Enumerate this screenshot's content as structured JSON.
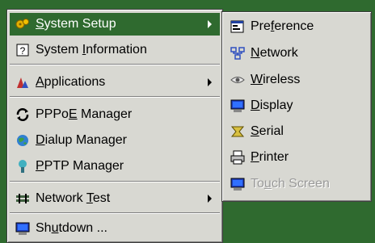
{
  "main_menu": {
    "items": [
      {
        "pre": "",
        "u": "S",
        "post": "ystem Setup",
        "icon": "system-setup-icon",
        "submenu": true,
        "highlighted": true
      },
      {
        "pre": "System ",
        "u": "I",
        "post": "nformation",
        "icon": "help-icon",
        "submenu": false
      },
      {
        "pre": "",
        "u": "A",
        "post": "pplications",
        "icon": "applications-icon",
        "submenu": true
      },
      {
        "pre": "PPPo",
        "u": "E",
        "post": " Manager",
        "icon": "pppoe-icon",
        "submenu": false
      },
      {
        "pre": "",
        "u": "D",
        "post": "ialup Manager",
        "icon": "dialup-icon",
        "submenu": false
      },
      {
        "pre": "",
        "u": "P",
        "post": "PTP Manager",
        "icon": "pptp-icon",
        "submenu": false
      },
      {
        "pre": "Network ",
        "u": "T",
        "post": "est",
        "icon": "network-test-icon",
        "submenu": true
      },
      {
        "pre": "Sh",
        "u": "u",
        "post": "tdown ...",
        "icon": "shutdown-icon",
        "submenu": false
      }
    ]
  },
  "sub_menu": {
    "items": [
      {
        "pre": "Pre",
        "u": "f",
        "post": "erence",
        "icon": "preference-icon"
      },
      {
        "pre": "",
        "u": "N",
        "post": "etwork",
        "icon": "network-icon"
      },
      {
        "pre": "",
        "u": "W",
        "post": "ireless",
        "icon": "wireless-icon"
      },
      {
        "pre": "",
        "u": "D",
        "post": "isplay",
        "icon": "display-icon"
      },
      {
        "pre": "",
        "u": "S",
        "post": "erial",
        "icon": "serial-icon"
      },
      {
        "pre": "",
        "u": "P",
        "post": "rinter",
        "icon": "printer-icon"
      },
      {
        "pre": "To",
        "u": "u",
        "post": "ch Screen",
        "icon": "touch-screen-icon",
        "disabled": true
      }
    ]
  },
  "colors": {
    "highlight": "#2f6a2f",
    "menu_bg": "#d8d8d2",
    "desktop": "#2f6a2f"
  }
}
